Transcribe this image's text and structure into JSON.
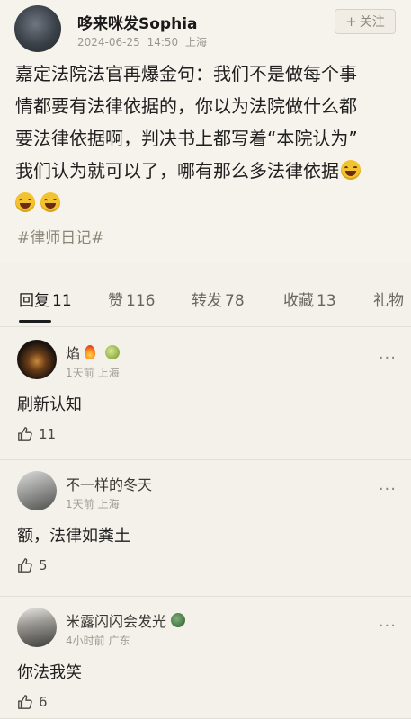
{
  "post": {
    "author": "哆来咪发Sophia",
    "date": "2024-06-25",
    "time": "14:50",
    "location": "上海",
    "follow_label": "关注",
    "follow_icon": "plus-icon",
    "body_lines": [
      "嘉定法院法官再爆金句：我们不是做每个事",
      "情都要有法律依据的，你以为法院做什么都",
      "要法律依据啊，判决书上都写着“本院认为”",
      "我们认为就可以了，哪有那么多法律依据"
    ],
    "emoji": "grinning-sweat-emoji",
    "tag": "#律师日记#"
  },
  "tabs": [
    {
      "label": "回复",
      "count": "11"
    },
    {
      "label": "赞",
      "count": "116"
    },
    {
      "label": "转发",
      "count": "78"
    },
    {
      "label": "收藏",
      "count": "13"
    },
    {
      "label": "礼物",
      "count": ""
    }
  ],
  "comments": [
    {
      "name": "焰",
      "time": "1天前",
      "location": "上海",
      "text": "刷新认知",
      "likes": "11",
      "badges": [
        "fire-icon",
        "lime-badge-icon"
      ]
    },
    {
      "name": "不一样的冬天",
      "time": "1天前",
      "location": "上海",
      "text": "额，法律如粪土",
      "likes": "5",
      "badges": []
    },
    {
      "name": "米露闪闪会发光",
      "time": "4小时前",
      "location": "广东",
      "text": "你法我笑",
      "likes": "6",
      "badges": [
        "green-badge-icon"
      ]
    }
  ],
  "colors": {
    "background": "#f4f1ea",
    "text": "#1f1f1f",
    "muted": "#9a9690",
    "tag": "#8b8679"
  }
}
